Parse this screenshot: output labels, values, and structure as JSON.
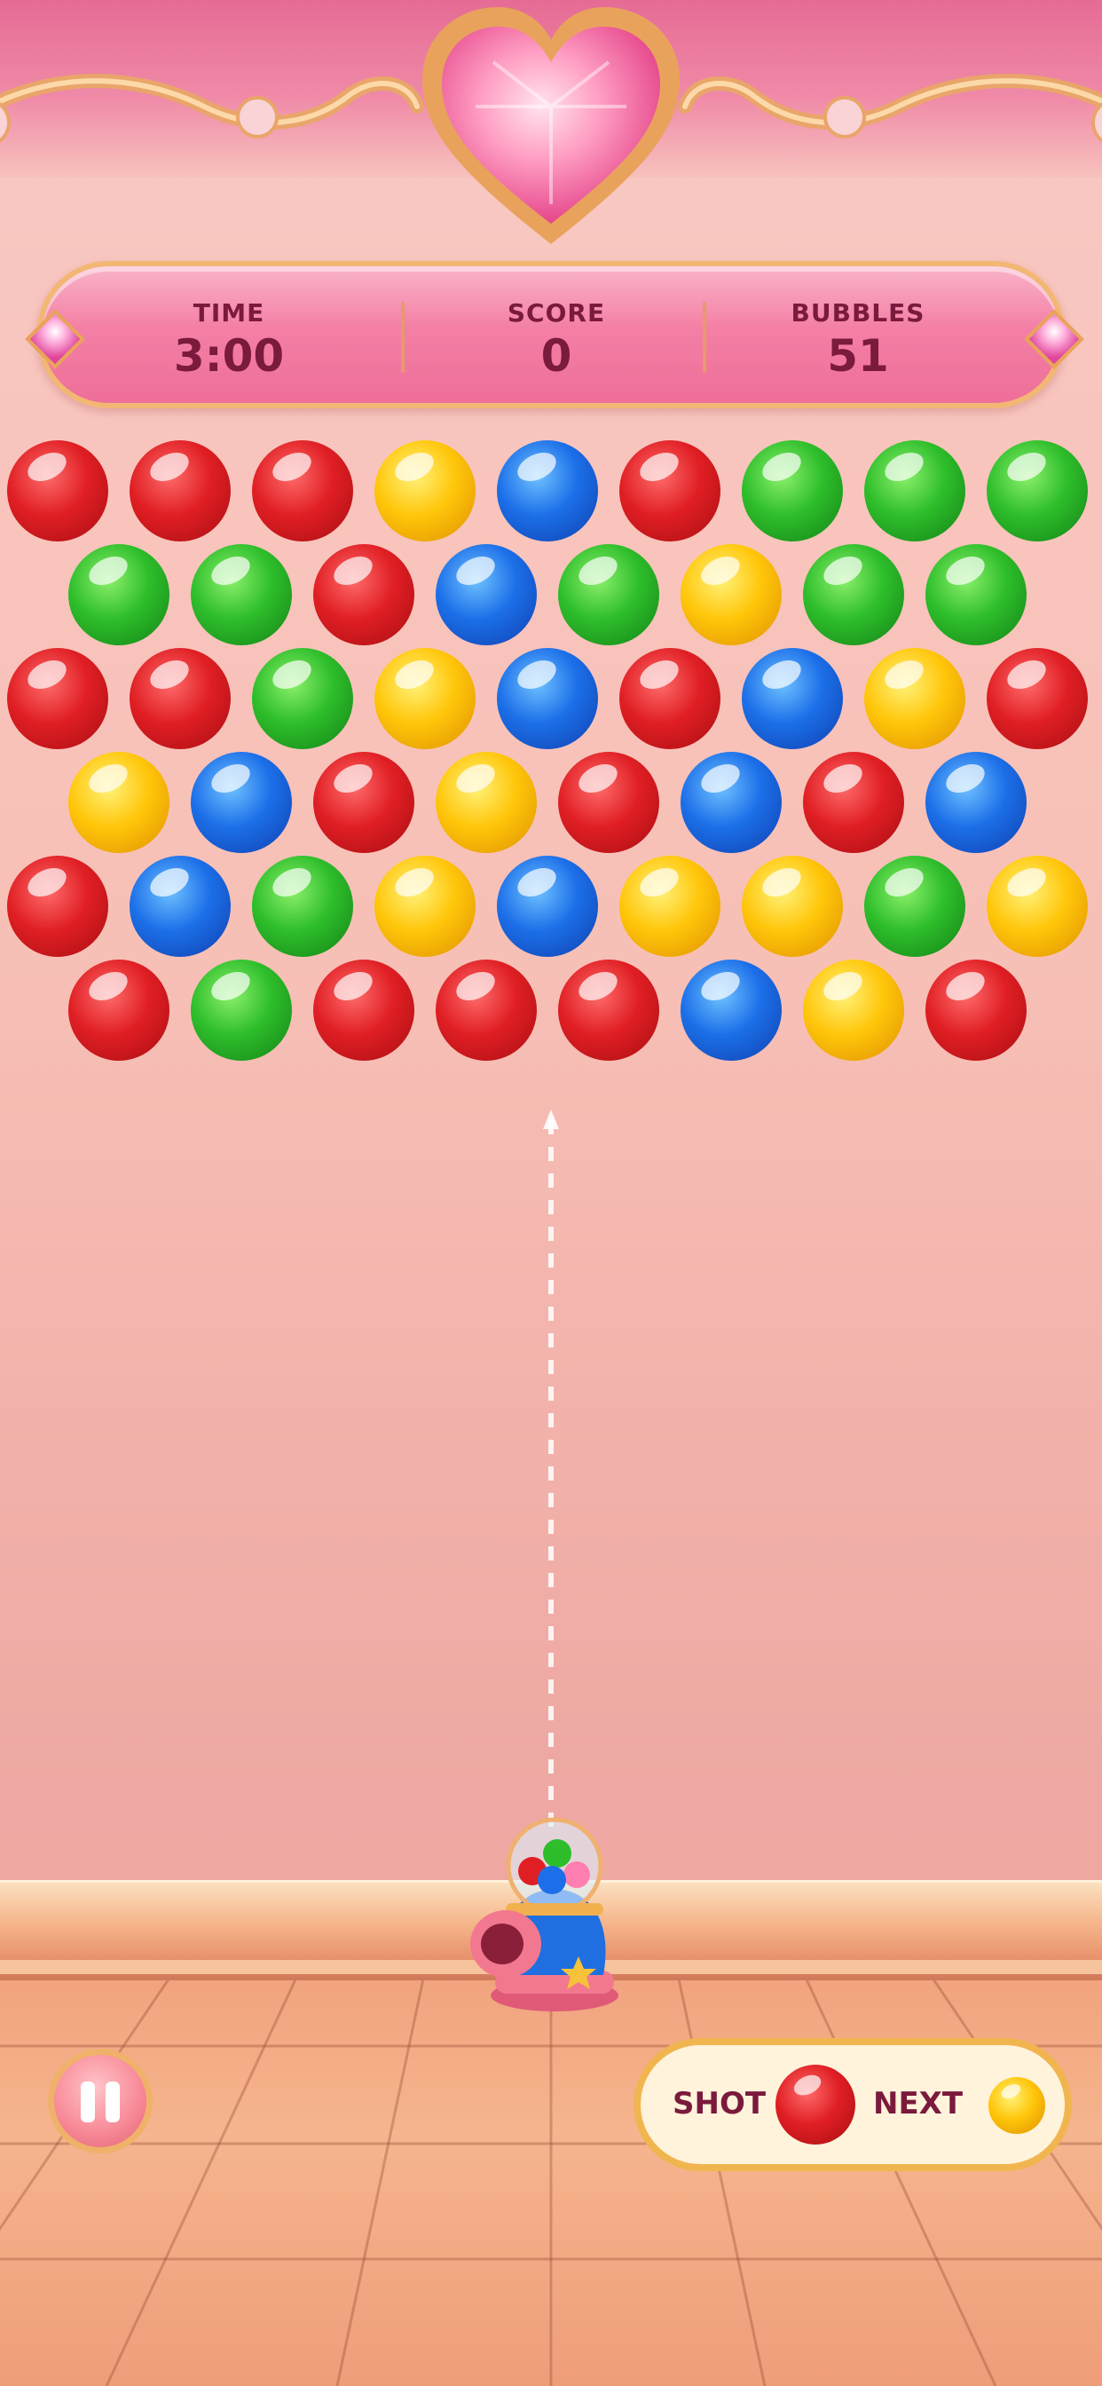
{
  "hud": {
    "time_label": "TIME",
    "time_value": "3:00",
    "score_label": "SCORE",
    "score_value": "0",
    "bubbles_label": "BUBBLES",
    "bubbles_value": "51"
  },
  "grid": {
    "rows": [
      [
        "red",
        "red",
        "red",
        "yellow",
        "blue",
        "red",
        "green",
        "green",
        "green"
      ],
      [
        "green",
        "green",
        "red",
        "blue",
        "green",
        "yellow",
        "green",
        "green"
      ],
      [
        "red",
        "red",
        "green",
        "yellow",
        "blue",
        "red",
        "blue",
        "yellow",
        "red"
      ],
      [
        "yellow",
        "blue",
        "red",
        "yellow",
        "red",
        "blue",
        "red",
        "blue"
      ],
      [
        "red",
        "blue",
        "green",
        "yellow",
        "blue",
        "yellow",
        "yellow",
        "green",
        "yellow"
      ],
      [
        "red",
        "green",
        "red",
        "red",
        "red",
        "blue",
        "yellow",
        "red"
      ]
    ]
  },
  "colors": {
    "red": "#e01f24",
    "yellow": "#ffc60a",
    "blue": "#1c6fe8",
    "green": "#2ebe2b",
    "hud_text": "#7a1a3c"
  },
  "queue": {
    "shot_label": "SHOT",
    "shot_color": "red",
    "next_label": "NEXT",
    "next_color": "yellow"
  },
  "icons": {
    "pause": "pause-icon",
    "heart": "heart-gem-icon",
    "cannon": "bubble-cannon-icon"
  }
}
